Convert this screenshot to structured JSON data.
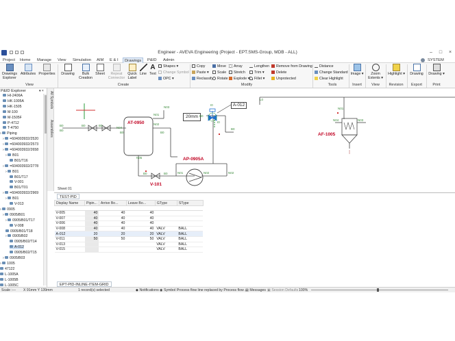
{
  "window": {
    "title": "Engineer - AVEVA Engineering (Project - EPT.SMS-Group, MDB - ALL)"
  },
  "menu": {
    "tabs": [
      "Project",
      "Home",
      "Manage",
      "View",
      "Simulation",
      "AIM",
      "E & I",
      "Drawings",
      "P&ID",
      "Admin"
    ],
    "user": "SYSTEM"
  },
  "ribbon": {
    "explorer": {
      "btn1": "Drawings",
      "btn1b": "Explorer",
      "btn2": "Attributes",
      "btn3": "Properties",
      "group": "View"
    },
    "create": {
      "drawing": "Drawing",
      "bulk": "Bulk",
      "bulk2": "Creation",
      "sheet": "Sheet",
      "repeat": "Repeat",
      "repeat2": "Connector",
      "quick": "Quick",
      "quick2": "Label",
      "line": "Line",
      "text": "Text",
      "shapes": "Shapes",
      "change_symbol": "Change Symbol",
      "opc": "OPC",
      "group": "Create"
    },
    "modify": {
      "copy": "Copy",
      "paste": "Paste",
      "reclassify": "Reclassify",
      "move": "Move",
      "scale": "Scale",
      "rotate": "Rotate",
      "array": "Array",
      "stretch": "Stretch",
      "explode": "Explode",
      "lengthen": "Lengthen",
      "trim": "Trim",
      "fillet": "Fillet",
      "remove": "Remove from Drawing",
      "delete": "Delete",
      "unprotected": "Unprotected",
      "group": "Modify"
    },
    "tools": {
      "distance": "Distance",
      "change_standard": "Change Standard",
      "clear_highlight": "Clear Highlight",
      "group": "Tools"
    },
    "insert": {
      "image": "Image",
      "group": "Insert"
    },
    "zoom": {
      "label": "Zoom",
      "label2": "Extents",
      "group": "View"
    },
    "revision": {
      "label": "Highlight",
      "group": "Revision"
    },
    "export": {
      "label": "Drawing",
      "group": "Export"
    },
    "print": {
      "label": "Drawing",
      "group": "Print"
    }
  },
  "explorer": {
    "title": "P&ID Explorer",
    "items": [
      "HI-2406A",
      "HK-1005A",
      "HK-1505",
      "M-100",
      "M-1505F",
      "P-4712",
      "T-4750",
      "Piping",
      "=604003932/2520",
      "=604003932/2573",
      "=604003932/2658",
      "B01",
      "B01/T16",
      "=604003932/2778",
      "B01",
      "B01/T17",
      "V-001",
      "B01/T01",
      "=604003932/2969",
      "B01",
      "V-013",
      "0905",
      "0905/B01",
      "0905/B01/T17",
      "V-008",
      "0905/B01/T18",
      "0905/B02",
      "0905/B02/T14",
      "A-012",
      "0905/B02/T15",
      "0905/B03",
      "1005",
      "47122",
      "L-1005A",
      "L-1005B",
      "L-1005C"
    ]
  },
  "side_tabs": {
    "t1": "All Symbols",
    "t2": "Assemblies"
  },
  "drawing": {
    "labels": {
      "at": "AT-0950",
      "v101": "V-101",
      "ap": "AP-0905A",
      "af": "AF-1005",
      "a012": "A-012",
      "dim": "20mm"
    },
    "sheet_tab": "Sheet 01",
    "small": [
      "N01",
      "N02",
      "N03",
      "N04",
      "N05",
      "B0",
      "B0",
      "B0",
      "B0",
      "B0",
      "B0",
      "B0",
      "B0",
      "I0",
      "I0",
      "N01",
      "N02",
      "N02",
      "N01",
      "N03",
      "N04",
      "L0",
      "B0",
      "B0"
    ]
  },
  "grid": {
    "tab": "TEST-PID",
    "bottom_tab": "EPT-PID-INLINE-ITEM-GRID",
    "columns": [
      "Display Name",
      "Pipin...",
      "Arrive Bo...",
      "Leave Bo...",
      "GType",
      "SType"
    ],
    "rows": [
      [
        "V-005",
        "40",
        "40",
        "40",
        "",
        ""
      ],
      [
        "V-007",
        "40",
        "40",
        "40",
        "",
        ""
      ],
      [
        "V-006",
        "40",
        "40",
        "40",
        "",
        ""
      ],
      [
        "V-008",
        "40",
        "40",
        "40",
        "VALV",
        "BALL"
      ],
      [
        "A-012",
        "20",
        "20",
        "20",
        "VALV",
        "BALL"
      ],
      [
        "V-011",
        "50",
        "50",
        "50",
        "VALV",
        "BALL"
      ],
      [
        "V-013",
        "",
        "",
        "",
        "VALV",
        "BALL"
      ],
      [
        "V-015",
        "",
        "",
        "",
        "VALV",
        "BALL"
      ]
    ]
  },
  "status": {
    "scale": "Scale :---",
    "coords": "X 91mm Y 139mm",
    "selection": "1 record(s) selected",
    "notifications": "Notifications",
    "message": "Symbol Process flow line replaced by Process flow ...",
    "messages": "Messages",
    "session": "Session Defaults",
    "zoom": "100%"
  }
}
